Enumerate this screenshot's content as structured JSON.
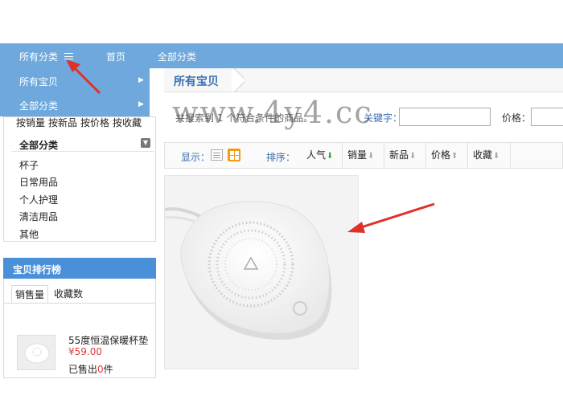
{
  "nav": {
    "all_categories_label": "所有分类",
    "home_label": "首页",
    "full_categories_label": "全部分类"
  },
  "dropdown": {
    "items": [
      "所有宝贝",
      "全部分类"
    ]
  },
  "sidebar": {
    "sort_links": [
      "按销量",
      "按新品",
      "按价格",
      "按收藏"
    ],
    "header": "全部分类",
    "categories": [
      "杯子",
      "日常用品",
      "个人护理",
      "清洁用品",
      "其他"
    ]
  },
  "ranking": {
    "title": "宝贝排行榜",
    "tabs": [
      "销售量",
      "收藏数"
    ],
    "product": {
      "name": "55度恒温保暖杯垫",
      "price": "¥59.00",
      "sold_prefix": "已售出",
      "sold_count": "0",
      "sold_suffix": "件"
    }
  },
  "main": {
    "title": "所有宝贝",
    "result_text": "共搜索到 1 个符合条件的商品。",
    "keyword_label": "关键字：",
    "price_label": "价格：",
    "watermark": "www.4y4.cc",
    "display_label": "显示：",
    "sort_label": "排序：",
    "sort_options": [
      "人气",
      "销量",
      "新品",
      "价格",
      "收藏"
    ]
  },
  "colors": {
    "nav_bg": "#6ea8dc",
    "rank_header_bg": "#4a90d9",
    "price_red": "#e4393c",
    "link_blue": "#3a6fb0",
    "grid_orange": "#f39c12",
    "annotation_red": "#e0302a"
  }
}
